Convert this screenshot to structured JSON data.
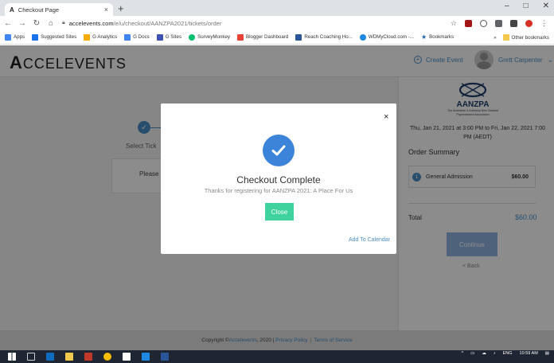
{
  "browser": {
    "tab_title": "Checkout Page",
    "tab_favicon": "A",
    "tab_close": "×",
    "new_tab": "+",
    "url_host": "accelevents.com",
    "url_path": "/e/u/checkout/AANZPA2021/tickets/order",
    "bookmarks": [
      {
        "label": "Apps",
        "color": "#4285f4"
      },
      {
        "label": "Suggested Sites",
        "color": "#1a73e8"
      },
      {
        "label": "G Analytics",
        "color": "#f9ab00"
      },
      {
        "label": "G Docs",
        "color": "#4285f4"
      },
      {
        "label": "G Sites",
        "color": "#3f51b5"
      },
      {
        "label": "SurveyMonkey",
        "color": "#00bf6f"
      },
      {
        "label": "Blogger Dashboard",
        "color": "#ea4335"
      },
      {
        "label": "Reach Coaching Ho...",
        "color": "#2b579a"
      },
      {
        "label": "WDMyCloud.com -...",
        "color": "#1e88e5"
      },
      {
        "label": "Bookmarks",
        "color": "#1e63b7"
      }
    ],
    "bookmarks_more": "»",
    "other_bookmarks": "Other bookmarks",
    "window_controls": [
      "–",
      "□",
      "✕"
    ]
  },
  "header": {
    "logo": "ACCELEVENTS",
    "logo_first": "A",
    "logo_rest": "CCELEVENTS",
    "create_event": "Create Event",
    "user_name": "Grett Carpenter"
  },
  "checkout": {
    "step_label": "Select Tick",
    "please_text": "Please"
  },
  "sidebar": {
    "org_name": "AANZPA",
    "org_subtitle": "The Australian & Aotearoa New Zealand Psychodrama Association",
    "event_date": "Thu, Jan 21, 2021 at 3:00 PM to Fri, Jan 22, 2021 7:00 PM (AEDT)",
    "order_summary": "Order Summary",
    "ticket": {
      "qty": "1",
      "name": "General Admission",
      "price": "$60.00"
    },
    "total_label": "Total",
    "total_value": "$60.00",
    "continue": "Continue",
    "back": "< Back"
  },
  "modal": {
    "close_icon": "×",
    "title": "Checkout Complete",
    "subtitle": "Thanks for registering for AANZPA 2021: A Place For Us",
    "close_button": "Close",
    "add_to_calendar": "Add To Calendar"
  },
  "footer": {
    "copyright_prefix": "Copyright ©",
    "brand": "Accelevents",
    "year": ", 2020 |",
    "privacy": "Privacy Policy",
    "sep": "|",
    "terms": "Terms of Service"
  },
  "taskbar": {
    "lang": "ENG",
    "time": "10:59 AM"
  },
  "colors": {
    "primary_blue": "#4a8ec6",
    "check_blue": "#3b84d9",
    "close_green": "#3dd29e",
    "continue_blue": "#8fb3e2"
  }
}
